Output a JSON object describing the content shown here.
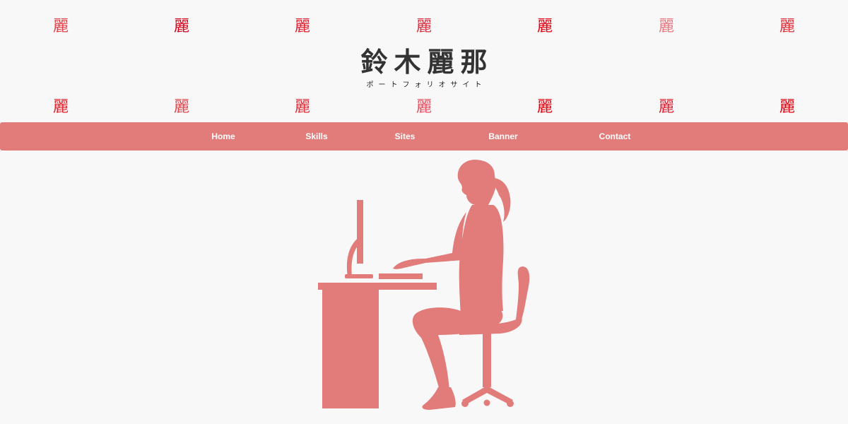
{
  "header": {
    "title": "鈴木麗那",
    "subtitle": "ポートフォリオサイト",
    "stamp_char": "麗"
  },
  "decorations": {
    "top_row": [
      {
        "char": "麗",
        "color": "#e0424a"
      },
      {
        "char": "麗",
        "color": "#d6001a"
      },
      {
        "char": "麗",
        "color": "#e0202e"
      },
      {
        "char": "麗",
        "color": "#d83040"
      },
      {
        "char": "麗",
        "color": "#e00010"
      },
      {
        "char": "麗",
        "color": "#e87880"
      },
      {
        "char": "麗",
        "color": "#e0303a"
      }
    ],
    "bottom_row": [
      {
        "char": "麗",
        "color": "#e0202a"
      },
      {
        "char": "麗",
        "color": "#e04850"
      },
      {
        "char": "麗",
        "color": "#e0303a"
      },
      {
        "char": "麗",
        "color": "#e85060"
      },
      {
        "char": "麗",
        "color": "#e00010"
      },
      {
        "char": "麗",
        "color": "#e02030"
      },
      {
        "char": "麗",
        "color": "#e00010"
      }
    ]
  },
  "nav": {
    "items": [
      {
        "label": "Home"
      },
      {
        "label": "Skills"
      },
      {
        "label": "Sites"
      },
      {
        "label": "Banner"
      },
      {
        "label": "Contact"
      }
    ]
  },
  "hero": {
    "illustration_icon": "woman-at-computer-desk-icon"
  },
  "colors": {
    "background": "#f8f8f9",
    "accent": "#e27c7a",
    "nav_text": "#ffffff",
    "title_text": "#333333"
  }
}
